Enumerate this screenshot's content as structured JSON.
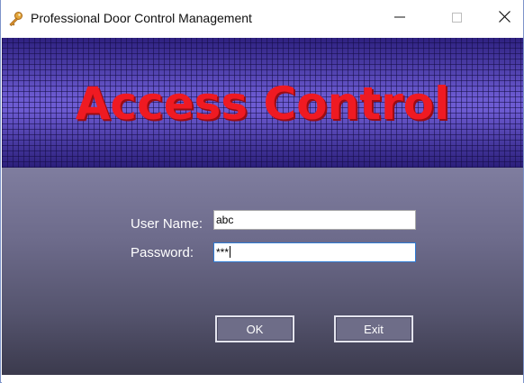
{
  "window": {
    "title": "Professional Door Control Management",
    "minimize_icon": "minimize-icon",
    "maximize_icon": "maximize-icon",
    "close_icon": "close-icon",
    "app_icon": "key-icon"
  },
  "banner": {
    "title": "Access Control",
    "title_color": "#ef1a22",
    "background_color": "#3f2d98"
  },
  "form": {
    "username_label": "User Name:",
    "username_value": "abc",
    "password_label": "Password:",
    "password_value": "***"
  },
  "buttons": {
    "ok_label": "OK",
    "exit_label": "Exit"
  }
}
